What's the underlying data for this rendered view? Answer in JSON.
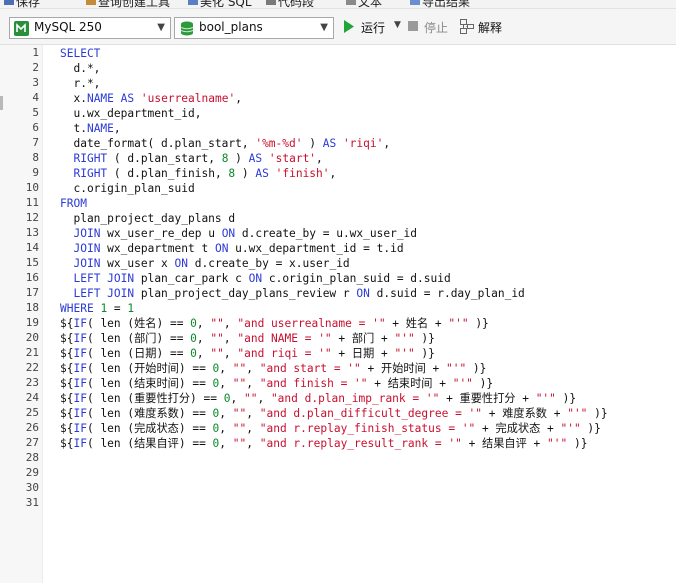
{
  "menubar": {
    "items": [
      {
        "label": "保存",
        "icon": "save-icon"
      },
      {
        "label": "查询创建工具",
        "icon": "query-builder-icon"
      },
      {
        "label": "美化 SQL",
        "icon": "beautify-icon"
      },
      {
        "label": "代码段",
        "icon": "snippet-icon"
      },
      {
        "label": "文本",
        "icon": "text-icon"
      },
      {
        "label": "导出结果",
        "icon": "export-icon"
      }
    ]
  },
  "toolbar": {
    "connection": {
      "value": "MySQL 250",
      "icon": "mysql-icon"
    },
    "database": {
      "value": "bool_plans",
      "icon": "database-icon"
    },
    "run_label": "运行",
    "stop_label": "停止",
    "explain_label": "解释"
  },
  "editor": {
    "line_numbers": [
      "1",
      "2",
      "3",
      "4",
      "5",
      "6",
      "7",
      "8",
      "9",
      "10",
      "11",
      "12",
      "13",
      "14",
      "15",
      "16",
      "17",
      "18",
      "19",
      "20",
      "21",
      "22",
      "23",
      "24",
      "25",
      "26",
      "27",
      "28",
      "29",
      "30",
      "31"
    ],
    "lines": [
      [
        {
          "t": "SELECT",
          "c": "k"
        }
      ],
      [
        {
          "t": "  d.*,",
          "c": "b"
        }
      ],
      [
        {
          "t": "  r.*,",
          "c": "b"
        }
      ],
      [
        {
          "t": "  x.",
          "c": "b"
        },
        {
          "t": "NAME",
          "c": "k"
        },
        {
          "t": " ",
          "c": "b"
        },
        {
          "t": "AS",
          "c": "k"
        },
        {
          "t": " ",
          "c": "b"
        },
        {
          "t": "'userrealname'",
          "c": "s"
        },
        {
          "t": ",",
          "c": "b"
        }
      ],
      [
        {
          "t": "  u.wx_department_id,",
          "c": "b"
        }
      ],
      [
        {
          "t": "  t.",
          "c": "b"
        },
        {
          "t": "NAME",
          "c": "k"
        },
        {
          "t": ",",
          "c": "b"
        }
      ],
      [
        {
          "t": "  date_format( d.plan_start, ",
          "c": "b"
        },
        {
          "t": "'%m-%d'",
          "c": "s"
        },
        {
          "t": " ) ",
          "c": "b"
        },
        {
          "t": "AS",
          "c": "k"
        },
        {
          "t": " ",
          "c": "b"
        },
        {
          "t": "'riqi'",
          "c": "s"
        },
        {
          "t": ",",
          "c": "b"
        }
      ],
      [
        {
          "t": "  ",
          "c": "b"
        },
        {
          "t": "RIGHT",
          "c": "k"
        },
        {
          "t": " ( d.plan_start, ",
          "c": "b"
        },
        {
          "t": "8",
          "c": "n"
        },
        {
          "t": " ) ",
          "c": "b"
        },
        {
          "t": "AS",
          "c": "k"
        },
        {
          "t": " ",
          "c": "b"
        },
        {
          "t": "'start'",
          "c": "s"
        },
        {
          "t": ",",
          "c": "b"
        }
      ],
      [
        {
          "t": "  ",
          "c": "b"
        },
        {
          "t": "RIGHT",
          "c": "k"
        },
        {
          "t": " ( d.plan_finish, ",
          "c": "b"
        },
        {
          "t": "8",
          "c": "n"
        },
        {
          "t": " ) ",
          "c": "b"
        },
        {
          "t": "AS",
          "c": "k"
        },
        {
          "t": " ",
          "c": "b"
        },
        {
          "t": "'finish'",
          "c": "s"
        },
        {
          "t": ",",
          "c": "b"
        }
      ],
      [
        {
          "t": "  c.origin_plan_suid",
          "c": "b"
        }
      ],
      [
        {
          "t": "FROM",
          "c": "k"
        }
      ],
      [
        {
          "t": "  plan_project_day_plans d",
          "c": "b"
        }
      ],
      [
        {
          "t": "  ",
          "c": "b"
        },
        {
          "t": "JOIN",
          "c": "k"
        },
        {
          "t": " wx_user_re_dep u ",
          "c": "b"
        },
        {
          "t": "ON",
          "c": "k"
        },
        {
          "t": " d.create_by = u.wx_user_id",
          "c": "b"
        }
      ],
      [
        {
          "t": "  ",
          "c": "b"
        },
        {
          "t": "JOIN",
          "c": "k"
        },
        {
          "t": " wx_department t ",
          "c": "b"
        },
        {
          "t": "ON",
          "c": "k"
        },
        {
          "t": " u.wx_department_id = t.id",
          "c": "b"
        }
      ],
      [
        {
          "t": "  ",
          "c": "b"
        },
        {
          "t": "JOIN",
          "c": "k"
        },
        {
          "t": " wx_user x ",
          "c": "b"
        },
        {
          "t": "ON",
          "c": "k"
        },
        {
          "t": " d.create_by = x.user_id",
          "c": "b"
        }
      ],
      [
        {
          "t": "  ",
          "c": "b"
        },
        {
          "t": "LEFT JOIN",
          "c": "k"
        },
        {
          "t": " plan_car_park c ",
          "c": "b"
        },
        {
          "t": "ON",
          "c": "k"
        },
        {
          "t": " c.origin_plan_suid = d.suid",
          "c": "b"
        }
      ],
      [
        {
          "t": "  ",
          "c": "b"
        },
        {
          "t": "LEFT JOIN",
          "c": "k"
        },
        {
          "t": " plan_project_day_plans_review r ",
          "c": "b"
        },
        {
          "t": "ON",
          "c": "k"
        },
        {
          "t": " d.suid = r.day_plan_id",
          "c": "b"
        }
      ],
      [
        {
          "t": "WHERE",
          "c": "k"
        },
        {
          "t": " ",
          "c": "b"
        },
        {
          "t": "1",
          "c": "n"
        },
        {
          "t": " = ",
          "c": "b"
        },
        {
          "t": "1",
          "c": "n"
        }
      ],
      [
        {
          "t": "${",
          "c": "b"
        },
        {
          "t": "IF",
          "c": "k"
        },
        {
          "t": "( len (姓名) == ",
          "c": "b"
        },
        {
          "t": "0",
          "c": "n"
        },
        {
          "t": ", ",
          "c": "b"
        },
        {
          "t": "\"\"",
          "c": "s"
        },
        {
          "t": ", ",
          "c": "b"
        },
        {
          "t": "\"and userrealname = '\"",
          "c": "s"
        },
        {
          "t": " + 姓名 + ",
          "c": "b"
        },
        {
          "t": "\"'\"",
          "c": "s"
        },
        {
          "t": " )}",
          "c": "b"
        }
      ],
      [
        {
          "t": "${",
          "c": "b"
        },
        {
          "t": "IF",
          "c": "k"
        },
        {
          "t": "( len (部门) == ",
          "c": "b"
        },
        {
          "t": "0",
          "c": "n"
        },
        {
          "t": ", ",
          "c": "b"
        },
        {
          "t": "\"\"",
          "c": "s"
        },
        {
          "t": ", ",
          "c": "b"
        },
        {
          "t": "\"and NAME = '\"",
          "c": "s"
        },
        {
          "t": " + 部门 + ",
          "c": "b"
        },
        {
          "t": "\"'\"",
          "c": "s"
        },
        {
          "t": " )}",
          "c": "b"
        }
      ],
      [
        {
          "t": "${",
          "c": "b"
        },
        {
          "t": "IF",
          "c": "k"
        },
        {
          "t": "( len (日期) == ",
          "c": "b"
        },
        {
          "t": "0",
          "c": "n"
        },
        {
          "t": ", ",
          "c": "b"
        },
        {
          "t": "\"\"",
          "c": "s"
        },
        {
          "t": ", ",
          "c": "b"
        },
        {
          "t": "\"and riqi = '\"",
          "c": "s"
        },
        {
          "t": " + 日期 + ",
          "c": "b"
        },
        {
          "t": "\"'\"",
          "c": "s"
        },
        {
          "t": " )}",
          "c": "b"
        }
      ],
      [
        {
          "t": "${",
          "c": "b"
        },
        {
          "t": "IF",
          "c": "k"
        },
        {
          "t": "( len (开始时间) == ",
          "c": "b"
        },
        {
          "t": "0",
          "c": "n"
        },
        {
          "t": ", ",
          "c": "b"
        },
        {
          "t": "\"\"",
          "c": "s"
        },
        {
          "t": ", ",
          "c": "b"
        },
        {
          "t": "\"and start = '\"",
          "c": "s"
        },
        {
          "t": " + 开始时间 + ",
          "c": "b"
        },
        {
          "t": "\"'\"",
          "c": "s"
        },
        {
          "t": " )}",
          "c": "b"
        }
      ],
      [
        {
          "t": "${",
          "c": "b"
        },
        {
          "t": "IF",
          "c": "k"
        },
        {
          "t": "( len (结束时间) == ",
          "c": "b"
        },
        {
          "t": "0",
          "c": "n"
        },
        {
          "t": ", ",
          "c": "b"
        },
        {
          "t": "\"\"",
          "c": "s"
        },
        {
          "t": ", ",
          "c": "b"
        },
        {
          "t": "\"and finish = '\"",
          "c": "s"
        },
        {
          "t": " + 结束时间 + ",
          "c": "b"
        },
        {
          "t": "\"'\"",
          "c": "s"
        },
        {
          "t": " )}",
          "c": "b"
        }
      ],
      [
        {
          "t": "${",
          "c": "b"
        },
        {
          "t": "IF",
          "c": "k"
        },
        {
          "t": "( len (重要性打分) == ",
          "c": "b"
        },
        {
          "t": "0",
          "c": "n"
        },
        {
          "t": ", ",
          "c": "b"
        },
        {
          "t": "\"\"",
          "c": "s"
        },
        {
          "t": ", ",
          "c": "b"
        },
        {
          "t": "\"and d.plan_imp_rank = '\"",
          "c": "s"
        },
        {
          "t": " + 重要性打分 + ",
          "c": "b"
        },
        {
          "t": "\"'\"",
          "c": "s"
        },
        {
          "t": " )}",
          "c": "b"
        }
      ],
      [
        {
          "t": "${",
          "c": "b"
        },
        {
          "t": "IF",
          "c": "k"
        },
        {
          "t": "( len (难度系数) == ",
          "c": "b"
        },
        {
          "t": "0",
          "c": "n"
        },
        {
          "t": ", ",
          "c": "b"
        },
        {
          "t": "\"\"",
          "c": "s"
        },
        {
          "t": ", ",
          "c": "b"
        },
        {
          "t": "\"and d.plan_difficult_degree = '\"",
          "c": "s"
        },
        {
          "t": " + 难度系数 + ",
          "c": "b"
        },
        {
          "t": "\"'\"",
          "c": "s"
        },
        {
          "t": " )}",
          "c": "b"
        }
      ],
      [
        {
          "t": "${",
          "c": "b"
        },
        {
          "t": "IF",
          "c": "k"
        },
        {
          "t": "( len (完成状态) == ",
          "c": "b"
        },
        {
          "t": "0",
          "c": "n"
        },
        {
          "t": ", ",
          "c": "b"
        },
        {
          "t": "\"\"",
          "c": "s"
        },
        {
          "t": ", ",
          "c": "b"
        },
        {
          "t": "\"and r.replay_finish_status = '\"",
          "c": "s"
        },
        {
          "t": " + 完成状态 + ",
          "c": "b"
        },
        {
          "t": "\"'\"",
          "c": "s"
        },
        {
          "t": " )}",
          "c": "b"
        }
      ],
      [
        {
          "t": "${",
          "c": "b"
        },
        {
          "t": "IF",
          "c": "k"
        },
        {
          "t": "( len (结果自评) == ",
          "c": "b"
        },
        {
          "t": "0",
          "c": "n"
        },
        {
          "t": ", ",
          "c": "b"
        },
        {
          "t": "\"\"",
          "c": "s"
        },
        {
          "t": ", ",
          "c": "b"
        },
        {
          "t": "\"and r.replay_result_rank = '\"",
          "c": "s"
        },
        {
          "t": " + 结果自评 + ",
          "c": "b"
        },
        {
          "t": "\"'\"",
          "c": "s"
        },
        {
          "t": " )}",
          "c": "b"
        }
      ]
    ]
  },
  "colors": {
    "keyword": "#2b3ad6",
    "string": "#c8102e",
    "number": "#0a8a2a",
    "run_green": "#1fa53a",
    "database_green": "#2e9a3c"
  }
}
